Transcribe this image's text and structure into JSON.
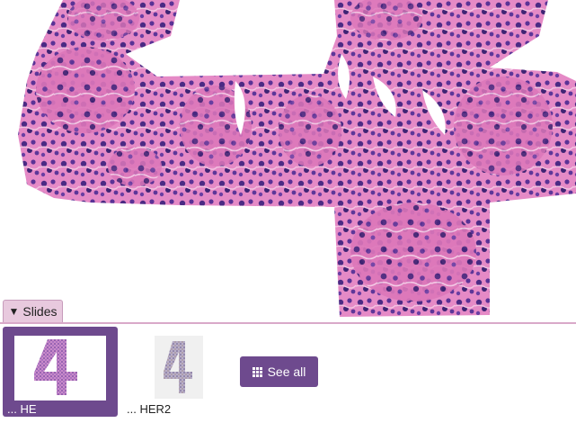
{
  "panel": {
    "toggle_glyph": "▼",
    "tab_label": "Slides"
  },
  "slides": [
    {
      "label": "... HE",
      "selected": true,
      "stain": "H&E",
      "thumbnail_char": "4"
    },
    {
      "label": "... HER2",
      "selected": false,
      "stain": "HER2",
      "thumbnail_char": "4"
    }
  ],
  "see_all": {
    "icon": "grid-icon",
    "label": "See all"
  },
  "colors": {
    "accent": "#6e4a8e",
    "tab_bg": "#e8c9de",
    "panel_line": "#d9a9c9",
    "tissue_pink": "#e27bbf",
    "nuclei": "#4b2a84"
  }
}
